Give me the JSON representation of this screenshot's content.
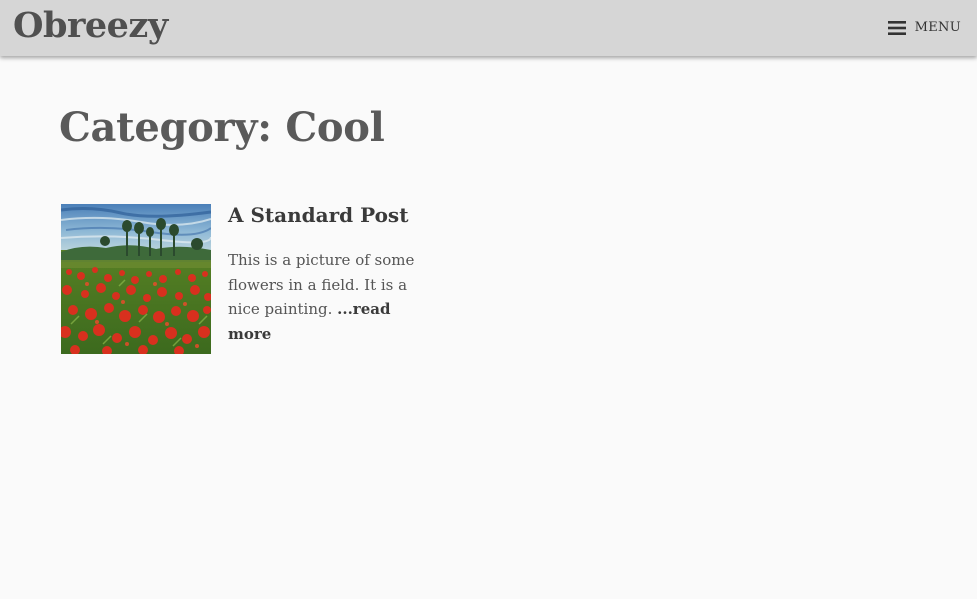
{
  "header": {
    "site_title": "Obreezy",
    "menu_label": "MENU",
    "menu_icon": "hamburger-menu-icon"
  },
  "main": {
    "page_title": "Category: Cool",
    "posts": [
      {
        "title": "A Standard Post",
        "excerpt": "This is a picture of some flowers in a field.  It is a nice painting. ",
        "read_more_label": "...read more",
        "thumbnail": "poppy-field-painting-thumbnail"
      }
    ]
  },
  "colors": {
    "header_background": "#d6d6d6",
    "page_background": "#fafafa",
    "title_text": "#5a5a5a",
    "body_text": "#555555",
    "link_text": "#3a3a3a"
  }
}
